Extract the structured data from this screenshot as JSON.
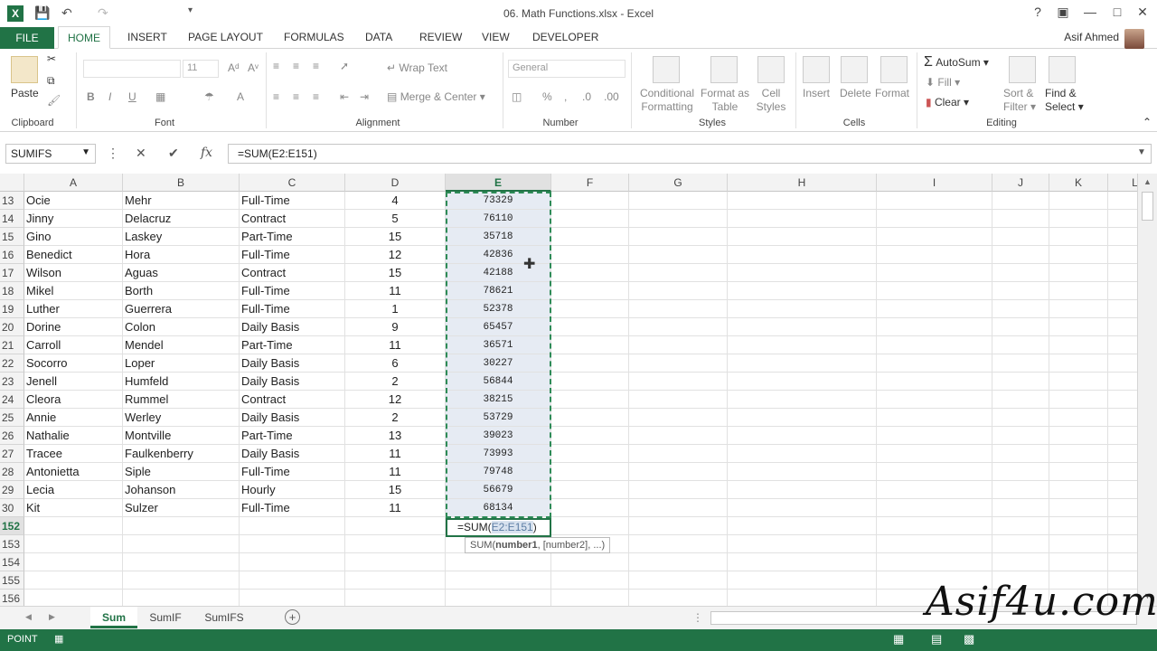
{
  "window": {
    "title": "06. Math Functions.xlsx - Excel",
    "help": "?",
    "user": "Asif Ahmed"
  },
  "tabs": [
    "FILE",
    "HOME",
    "INSERT",
    "PAGE LAYOUT",
    "FORMULAS",
    "DATA",
    "REVIEW",
    "VIEW",
    "DEVELOPER"
  ],
  "ribbon": {
    "paste": "Paste",
    "font_size": "11",
    "wrap_text": "Wrap Text",
    "merge_center": "Merge & Center",
    "number_format": "General",
    "cond_format_1": "Conditional",
    "cond_format_2": "Formatting",
    "format_table_1": "Format as",
    "format_table_2": "Table",
    "cell_styles_1": "Cell",
    "cell_styles_2": "Styles",
    "insert": "Insert",
    "delete": "Delete",
    "format": "Format",
    "autosum": "AutoSum",
    "fill": "Fill",
    "clear": "Clear",
    "sort_1": "Sort &",
    "sort_2": "Filter",
    "find_1": "Find &",
    "find_2": "Select",
    "groups": {
      "clipboard": "Clipboard",
      "font": "Font",
      "alignment": "Alignment",
      "number": "Number",
      "styles": "Styles",
      "cells": "Cells",
      "editing": "Editing"
    }
  },
  "formula_bar": {
    "name_box": "SUMIFS",
    "formula": "=SUM(E2:E151)"
  },
  "columns": [
    "A",
    "B",
    "C",
    "D",
    "E",
    "F",
    "G",
    "H",
    "I",
    "J",
    "K",
    "L"
  ],
  "rows": [
    {
      "n": "13",
      "a": "Ocie",
      "b": "Mehr",
      "c": "Full-Time",
      "d": "4",
      "e": "73329"
    },
    {
      "n": "14",
      "a": "Jinny",
      "b": "Delacruz",
      "c": "Contract",
      "d": "5",
      "e": "76110"
    },
    {
      "n": "15",
      "a": "Gino",
      "b": "Laskey",
      "c": "Part-Time",
      "d": "15",
      "e": "35718"
    },
    {
      "n": "16",
      "a": "Benedict",
      "b": "Hora",
      "c": "Full-Time",
      "d": "12",
      "e": "42836"
    },
    {
      "n": "17",
      "a": "Wilson",
      "b": "Aguas",
      "c": "Contract",
      "d": "15",
      "e": "42188"
    },
    {
      "n": "18",
      "a": "Mikel",
      "b": "Borth",
      "c": "Full-Time",
      "d": "11",
      "e": "78621"
    },
    {
      "n": "19",
      "a": "Luther",
      "b": "Guerrera",
      "c": "Full-Time",
      "d": "1",
      "e": "52378"
    },
    {
      "n": "20",
      "a": "Dorine",
      "b": "Colon",
      "c": "Daily Basis",
      "d": "9",
      "e": "65457"
    },
    {
      "n": "21",
      "a": "Carroll",
      "b": "Mendel",
      "c": "Part-Time",
      "d": "11",
      "e": "36571"
    },
    {
      "n": "22",
      "a": "Socorro",
      "b": "Loper",
      "c": "Daily Basis",
      "d": "6",
      "e": "30227"
    },
    {
      "n": "23",
      "a": "Jenell",
      "b": "Humfeld",
      "c": "Daily Basis",
      "d": "2",
      "e": "56844"
    },
    {
      "n": "24",
      "a": "Cleora",
      "b": "Rummel",
      "c": "Contract",
      "d": "12",
      "e": "38215"
    },
    {
      "n": "25",
      "a": "Annie",
      "b": "Werley",
      "c": "Daily Basis",
      "d": "2",
      "e": "53729"
    },
    {
      "n": "26",
      "a": "Nathalie",
      "b": "Montville",
      "c": "Part-Time",
      "d": "13",
      "e": "39023"
    },
    {
      "n": "27",
      "a": "Tracee",
      "b": "Faulkenberry",
      "c": "Daily Basis",
      "d": "11",
      "e": "73993"
    },
    {
      "n": "28",
      "a": "Antonietta",
      "b": "Siple",
      "c": "Full-Time",
      "d": "11",
      "e": "79748"
    },
    {
      "n": "29",
      "a": "Lecia",
      "b": "Johanson",
      "c": "Hourly",
      "d": "15",
      "e": "56679"
    },
    {
      "n": "30",
      "a": "Kit",
      "b": "Sulzer",
      "c": "Full-Time",
      "d": "11",
      "e": "68134"
    },
    {
      "n": "152",
      "a": "",
      "b": "",
      "c": "",
      "d": "",
      "e": ""
    },
    {
      "n": "153",
      "a": "",
      "b": "",
      "c": "",
      "d": "",
      "e": ""
    },
    {
      "n": "154",
      "a": "",
      "b": "",
      "c": "",
      "d": "",
      "e": ""
    },
    {
      "n": "155",
      "a": "",
      "b": "",
      "c": "",
      "d": "",
      "e": ""
    },
    {
      "n": "156",
      "a": "",
      "b": "",
      "c": "",
      "d": "",
      "e": ""
    }
  ],
  "edit_cell": {
    "prefix": "=SUM(",
    "ref": "E2:E151",
    "suffix": ")"
  },
  "tooltip": {
    "fn": "SUM(",
    "arg1": "number1",
    "rest": ", [number2], ...)"
  },
  "sheets": [
    "Sum",
    "SumIF",
    "SumIFS"
  ],
  "active_sheet": "Sum",
  "status": {
    "mode": "POINT"
  },
  "watermark": "Asif4u.com",
  "colors": {
    "accent": "#217346",
    "selection": "#e6ebf3"
  }
}
